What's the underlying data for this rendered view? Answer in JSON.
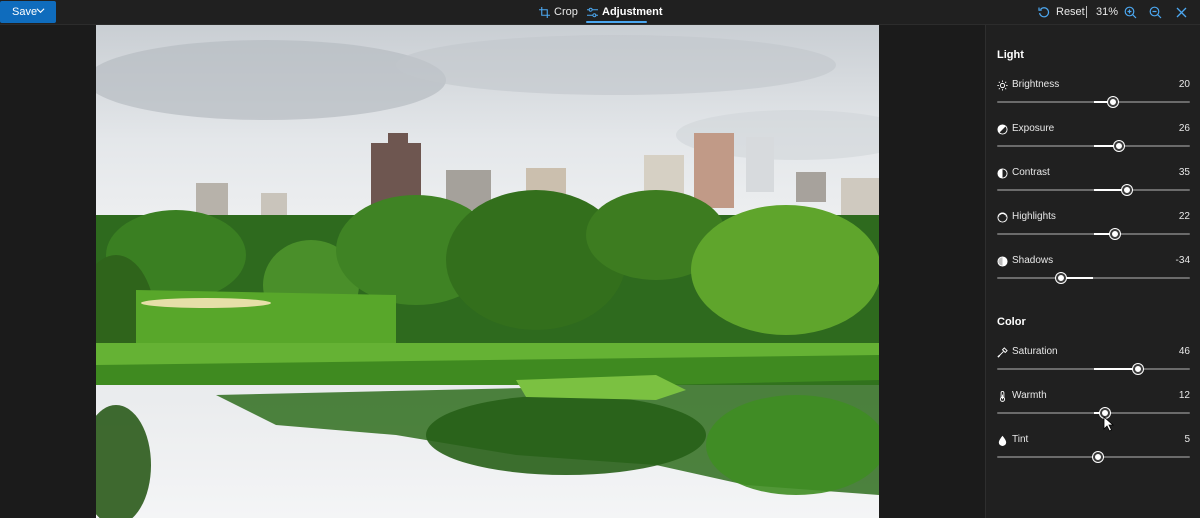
{
  "toolbar": {
    "save_label": "Save",
    "tabs": [
      {
        "label": "Crop",
        "icon": "crop-icon"
      },
      {
        "label": "Adjustment",
        "icon": "adjustment-icon",
        "active": true
      }
    ],
    "reset_label": "Reset",
    "zoom": "31%"
  },
  "panel": {
    "light": {
      "title": "Light",
      "sliders": [
        {
          "label": "Brightness",
          "value": "20",
          "icon": "brightness-icon",
          "level": 20
        },
        {
          "label": "Exposure",
          "value": "26",
          "icon": "exposure-icon",
          "level": 26
        },
        {
          "label": "Contrast",
          "value": "35",
          "icon": "contrast-icon",
          "level": 35
        },
        {
          "label": "Highlights",
          "value": "22",
          "icon": "highlights-icon",
          "level": 22
        },
        {
          "label": "Shadows",
          "value": "-34",
          "icon": "shadows-icon",
          "level": -34
        }
      ]
    },
    "color": {
      "title": "Color",
      "sliders": [
        {
          "label": "Saturation",
          "value": "46",
          "icon": "saturation-icon",
          "level": 46
        },
        {
          "label": "Warmth",
          "value": "12",
          "icon": "warmth-icon",
          "level": 12
        },
        {
          "label": "Tint",
          "value": "5",
          "icon": "tint-icon",
          "level": 5
        }
      ]
    }
  },
  "colors": {
    "accent": "#0f6cbd",
    "tab_underline": "#4ca7f0",
    "panel_bg": "#202020",
    "canvas_bg": "#1b1b1b"
  }
}
